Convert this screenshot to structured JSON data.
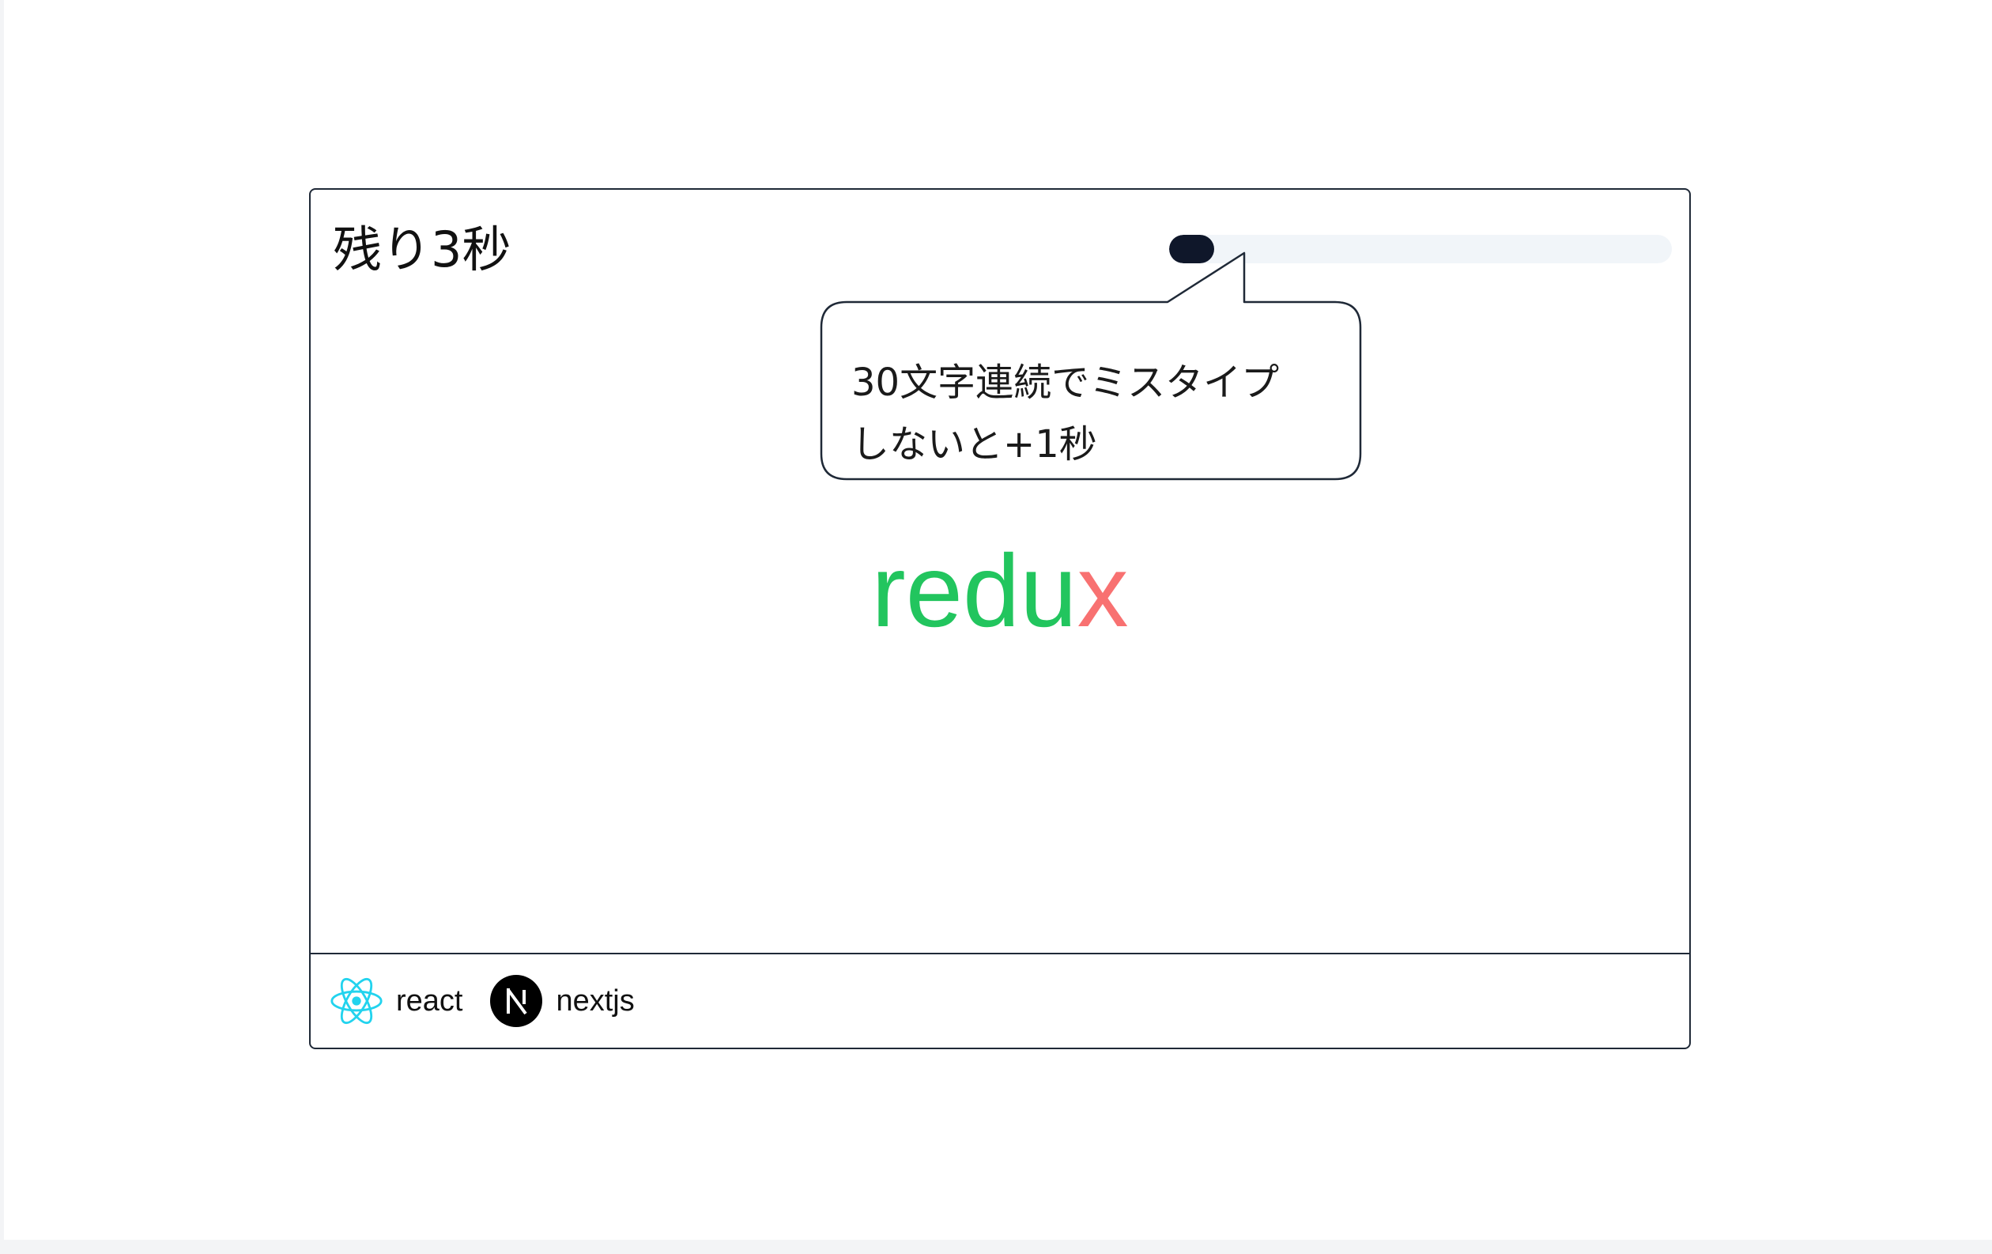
{
  "timer": {
    "label": "残り3秒"
  },
  "progress": {
    "fraction": 0.09,
    "fill_color": "#0f172a",
    "track_color": "#f1f5f9"
  },
  "hint": {
    "line1": "30文字連続でミスタイプ",
    "line2": "しないと+1秒"
  },
  "word": {
    "typed": "redu",
    "remaining": "x",
    "typed_color": "#22c55e",
    "remaining_color": "#f87171"
  },
  "tags": [
    {
      "label": "react",
      "icon": "react-icon"
    },
    {
      "label": "nextjs",
      "icon": "nextjs-icon"
    }
  ]
}
